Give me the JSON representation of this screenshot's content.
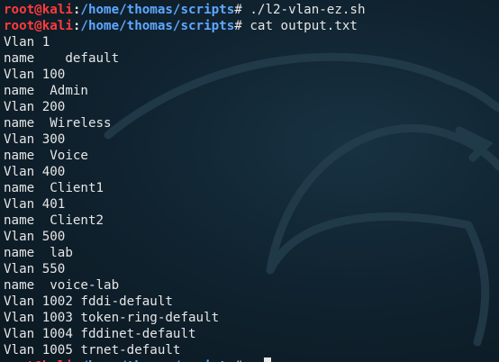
{
  "prompt": {
    "user_host": "root@kali",
    "colon": ":",
    "path": "/home/thomas/scripts",
    "sign": "#"
  },
  "commands": [
    "./l2-vlan-ez.sh",
    "cat output.txt"
  ],
  "output_lines": [
    "Vlan 1",
    "name    default",
    "Vlan 100",
    "name  Admin",
    "Vlan 200",
    "name  Wireless",
    "Vlan 300",
    "name  Voice",
    "Vlan 400",
    "name  Client1",
    "Vlan 401",
    "name  Client2",
    "Vlan 500",
    "name  lab",
    "Vlan 550",
    "name  voice-lab",
    "Vlan 1002 fddi-default",
    "Vlan 1003 token-ring-default",
    "Vlan 1004 fddinet-default",
    "Vlan 1005 trnet-default"
  ],
  "colors": {
    "background": "#0d1b26",
    "prompt_user": "#ff3b3b",
    "prompt_path": "#5fa8ff",
    "text": "#e6e6e6"
  }
}
